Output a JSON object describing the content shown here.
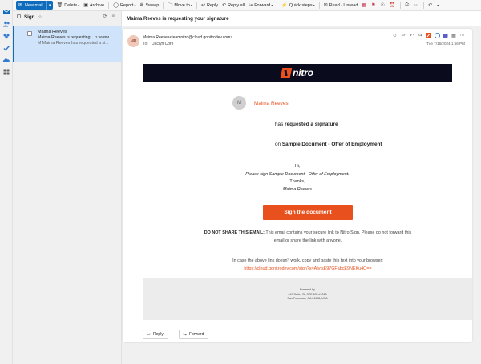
{
  "toolbar": {
    "new_mail": "New mail",
    "delete": "Delete",
    "archive": "Archive",
    "report": "Report",
    "sweep": "Sweep",
    "move_to": "Move to",
    "reply": "Reply",
    "reply_all": "Reply all",
    "forward": "Forward",
    "quick_steps": "Quick steps",
    "read_unread": "Read / Unread"
  },
  "folder": {
    "title": "Sign"
  },
  "message_item": {
    "sender": "Maima Reeves",
    "subject": "Maima Reeves is requesting...",
    "time": "1:56 PM",
    "preview": "M Maima Reeves has requested a si..."
  },
  "reading": {
    "subject": "Maima Reeves is requesting your signature",
    "avatar_initials": "MR",
    "from": "Maima Reeves<teamnitro@cloud.gonitrodev.com>",
    "to_label": "To:",
    "to_name": "Jaclyn Core",
    "date": "Tue 7/16/2024 1:56 PM"
  },
  "email": {
    "logo_text": "nitro",
    "requester_initial": "M",
    "requester_name": "Maima Reeves",
    "has_text": "has ",
    "requested_text": "requested a signature",
    "on_text": "on ",
    "document_name": "Sample Document - Offer of Employment",
    "greeting": "Hi,",
    "instruction": "Please sign Sample Document - Offer of Employment.",
    "thanks": "Thanks,",
    "signoff": "Maima Reeves",
    "sign_button": "Sign the document",
    "warning_bold": "DO NOT SHARE THIS EMAIL:",
    "warning_text": " This email contains your secure link to Nitro Sign. Please do not forward this email or share the link with anyone.",
    "fallback_text": "In case the above link doesn't work, copy and paste this text into your browser:",
    "fallback_link": "https://cloud.gonitrodev.com/sign?s=AIvfsE97GFabcE9NEKu4Q==",
    "footer_powered": "Powered by",
    "footer_address1": "447 Sutter St, STE 405 #1013",
    "footer_address2": "San Francisco, CA 94108, USA"
  },
  "actions": {
    "reply": "Reply",
    "forward": "Forward"
  },
  "colors": {
    "accent": "#0f6cbd",
    "nitro_orange": "#e8501d",
    "banner": "#0b0b1e"
  }
}
